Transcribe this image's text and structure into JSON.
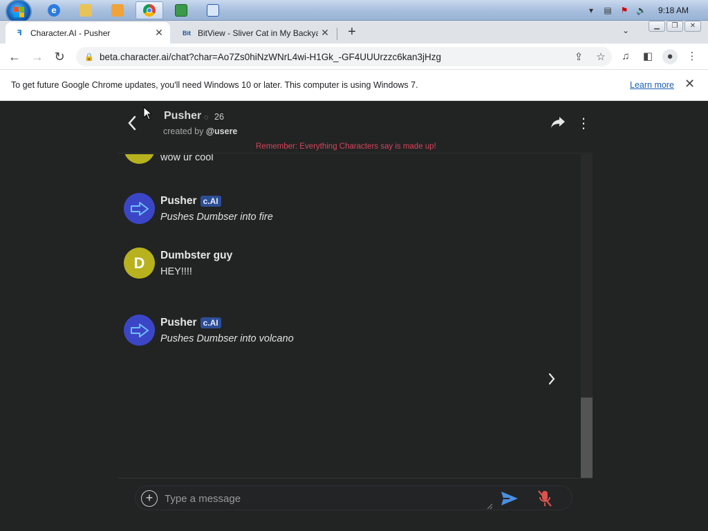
{
  "taskbar": {
    "clock": "9:18 AM",
    "apps": [
      "internet-explorer",
      "file-explorer",
      "media-player",
      "chrome",
      "app-green",
      "app-blue"
    ]
  },
  "browser": {
    "tabs": [
      {
        "title": "Character.AI - Pusher",
        "active": true
      },
      {
        "title": "BitView - Sliver Cat in My Backyard",
        "active": false
      }
    ],
    "url": "beta.character.ai/chat?char=Ao7Zs0hiNzWNrL4wi-H1Gk_-GF4UUUrzzc6kan3jHzg",
    "infobar": {
      "message": "To get future Google Chrome updates, you'll need Windows 10 or later. This computer is using Windows 7.",
      "link": "Learn more"
    }
  },
  "chat": {
    "character_name": "Pusher",
    "chat_count": "26",
    "created_by_prefix": "created by ",
    "creator": "@usere",
    "disclaimer": "Remember: Everything Characters say is made up!",
    "messages": [
      {
        "sender": "",
        "text": "wow ur  cool",
        "avatar": "dumbster"
      },
      {
        "sender": "Pusher",
        "badge": "c.AI",
        "text": "Pushes Dumbser into fire",
        "avatar": "pusher"
      },
      {
        "sender": "Dumbster guy",
        "avatar_letter": "D",
        "text": "HEY!!!!",
        "avatar": "dumbster"
      },
      {
        "sender": "Pusher",
        "badge": "c.AI",
        "text": "Pushes Dumbser into volcano",
        "avatar": "pusher"
      }
    ],
    "input_placeholder": "Type a message"
  },
  "colors": {
    "page_bg": "#222323",
    "pusher_avatar": "#3b46c7",
    "dumbster_avatar": "#b7b21d",
    "disclaimer": "#d6455c",
    "send_icon": "#4a90e2",
    "mic_icon": "#d9534f"
  }
}
